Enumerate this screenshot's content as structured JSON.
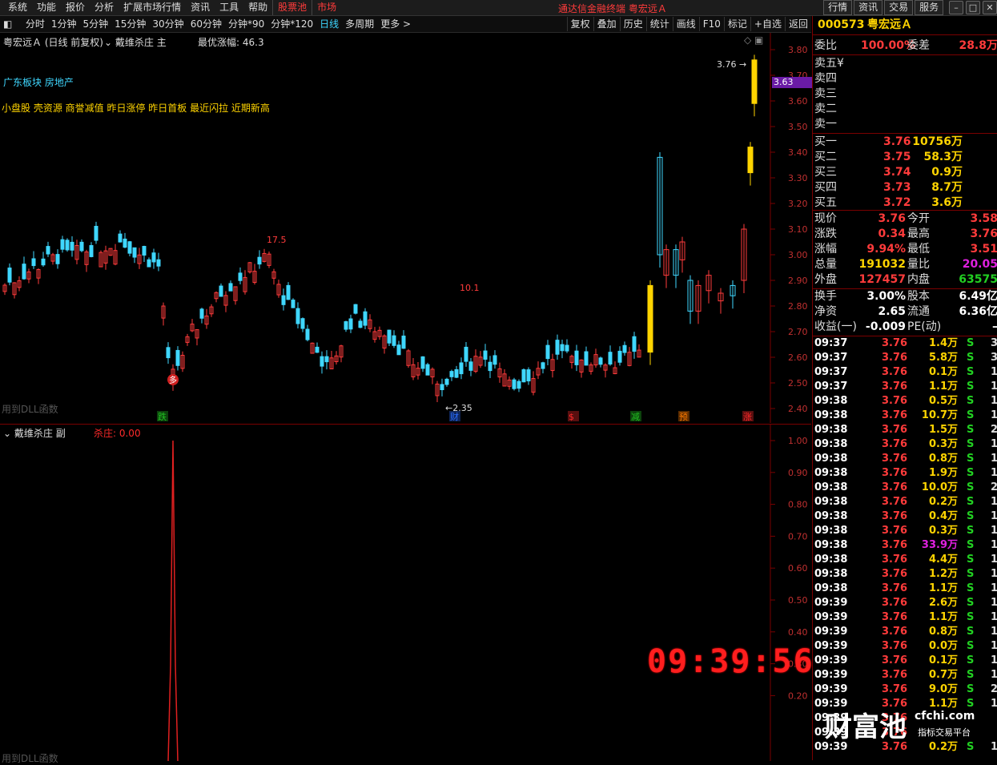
{
  "menubar": {
    "items": [
      "系统",
      "功能",
      "报价",
      "分析",
      "扩展市场行情",
      "资讯",
      "工具",
      "帮助"
    ],
    "red_items": [
      "股票池",
      "市场"
    ],
    "center_title": "通达信金融终端  粤宏远Ａ",
    "right_buttons": [
      "行情",
      "资讯",
      "交易",
      "服务"
    ],
    "window_buttons": [
      "–",
      "□",
      "✕"
    ]
  },
  "toolbar": {
    "periods": [
      "分时",
      "1分钟",
      "5分钟",
      "15分钟",
      "30分钟",
      "60分钟",
      "分钟*90",
      "分钟*120",
      "日线",
      "多周期",
      "更多 >"
    ],
    "active": "日线",
    "right": [
      "复权",
      "叠加",
      "历史",
      "统计",
      "画线",
      "F10",
      "标记",
      "+自选",
      "返回"
    ]
  },
  "main_chart": {
    "title": "粤宏远Ａ (日线 前复权)",
    "indicator": "戴维杀庄 主",
    "optimal_rise_label": "最优涨幅: 46.3",
    "sector_label": "广东板块  房地产",
    "concepts_label": "小盘股 壳资源 商誉减值 昨日涨停 昨日首板 最近闪拉 近期新高",
    "dll_label": "用到DLL函数",
    "price_ticks": [
      "3.80",
      "3.70",
      "3.60",
      "3.50",
      "3.40",
      "3.30",
      "3.20",
      "3.10",
      "3.00",
      "2.90",
      "2.80",
      "2.70",
      "2.60",
      "2.50",
      "2.40"
    ],
    "current_price_tag": "3.63",
    "annotations": {
      "high1": "17.5",
      "high2": "10.1",
      "low": "←2.35",
      "top": "3.76 →"
    },
    "markers": [
      "跌",
      "财",
      "$",
      "减",
      "预",
      "涨"
    ],
    "marker_colors": [
      "#22c022",
      "#2a6cff",
      "#ff2a2a",
      "#22c022",
      "#ff7a00",
      "#ff2a2a"
    ],
    "duo_label": "多"
  },
  "sub_chart": {
    "indicator": "戴维杀庄 副",
    "value_label": "杀庄: 0.00",
    "dll_label": "用到DLL函数",
    "ticks": [
      "1.00",
      "0.90",
      "0.80",
      "0.70",
      "0.60",
      "0.50",
      "0.40",
      "0.30",
      "0.20"
    ]
  },
  "clock": "09:39:56",
  "quote": {
    "code": "000573",
    "name": "粤宏远Ａ",
    "wei_bi_label": "委比",
    "wei_bi": "100.00%",
    "wei_cha_label": "委差",
    "wei_cha": "28.8万",
    "sell_levels": [
      {
        "label": "卖五",
        "price": "¥",
        "vol": ""
      },
      {
        "label": "卖四",
        "price": "",
        "vol": ""
      },
      {
        "label": "卖三",
        "price": "",
        "vol": ""
      },
      {
        "label": "卖二",
        "price": "",
        "vol": ""
      },
      {
        "label": "卖一",
        "price": "",
        "vol": ""
      }
    ],
    "buy_levels": [
      {
        "label": "买一",
        "price": "3.76",
        "vol": "10756万"
      },
      {
        "label": "买二",
        "price": "3.75",
        "vol": "58.3万"
      },
      {
        "label": "买三",
        "price": "3.74",
        "vol": "0.9万"
      },
      {
        "label": "买四",
        "price": "3.73",
        "vol": "8.7万"
      },
      {
        "label": "买五",
        "price": "3.72",
        "vol": "3.6万"
      }
    ],
    "stats": [
      {
        "l1": "现价",
        "v1": "3.76",
        "c1": "#ff3b3b",
        "l2": "今开",
        "v2": "3.58",
        "c2": "#ff3b3b"
      },
      {
        "l1": "涨跌",
        "v1": "0.34",
        "c1": "#ff3b3b",
        "l2": "最高",
        "v2": "3.76",
        "c2": "#ff3b3b"
      },
      {
        "l1": "涨幅",
        "v1": "9.94%",
        "c1": "#ff3b3b",
        "l2": "最低",
        "v2": "3.51",
        "c2": "#ff3b3b"
      },
      {
        "l1": "总量",
        "v1": "191032",
        "c1": "#ffd400",
        "l2": "量比",
        "v2": "20.05",
        "c2": "#e020e0"
      },
      {
        "l1": "外盘",
        "v1": "127457",
        "c1": "#ff3b3b",
        "l2": "内盘",
        "v2": "63575",
        "c2": "#22d022"
      }
    ],
    "stats2": [
      {
        "l1": "换手",
        "v1": "3.00%",
        "l2": "股本",
        "v2": "6.49亿"
      },
      {
        "l1": "净资",
        "v1": "2.65",
        "l2": "流通",
        "v2": "6.36亿"
      },
      {
        "l1": "收益(一)",
        "v1": "-0.009",
        "l2": "PE(动)",
        "v2": "–"
      }
    ]
  },
  "ticks": [
    {
      "t": "09:37",
      "p": "3.76",
      "v": "1.4万",
      "s": "S",
      "n": "3"
    },
    {
      "t": "09:37",
      "p": "3.76",
      "v": "5.8万",
      "s": "S",
      "n": "3"
    },
    {
      "t": "09:37",
      "p": "3.76",
      "v": "0.1万",
      "s": "S",
      "n": "1"
    },
    {
      "t": "09:37",
      "p": "3.76",
      "v": "1.1万",
      "s": "S",
      "n": "1"
    },
    {
      "t": "09:38",
      "p": "3.76",
      "v": "0.5万",
      "s": "S",
      "n": "1"
    },
    {
      "t": "09:38",
      "p": "3.76",
      "v": "10.7万",
      "s": "S",
      "n": "1"
    },
    {
      "t": "09:38",
      "p": "3.76",
      "v": "1.5万",
      "s": "S",
      "n": "2"
    },
    {
      "t": "09:38",
      "p": "3.76",
      "v": "0.3万",
      "s": "S",
      "n": "1"
    },
    {
      "t": "09:38",
      "p": "3.76",
      "v": "0.8万",
      "s": "S",
      "n": "1"
    },
    {
      "t": "09:38",
      "p": "3.76",
      "v": "1.9万",
      "s": "S",
      "n": "1"
    },
    {
      "t": "09:38",
      "p": "3.76",
      "v": "10.0万",
      "s": "S",
      "n": "2"
    },
    {
      "t": "09:38",
      "p": "3.76",
      "v": "0.2万",
      "s": "S",
      "n": "1"
    },
    {
      "t": "09:38",
      "p": "3.76",
      "v": "0.4万",
      "s": "S",
      "n": "1"
    },
    {
      "t": "09:38",
      "p": "3.76",
      "v": "0.3万",
      "s": "S",
      "n": "1"
    },
    {
      "t": "09:38",
      "p": "3.76",
      "v": "33.9万",
      "s": "S",
      "n": "1",
      "hl": true
    },
    {
      "t": "09:38",
      "p": "3.76",
      "v": "4.4万",
      "s": "S",
      "n": "1"
    },
    {
      "t": "09:38",
      "p": "3.76",
      "v": "1.2万",
      "s": "S",
      "n": "1"
    },
    {
      "t": "09:38",
      "p": "3.76",
      "v": "1.1万",
      "s": "S",
      "n": "1"
    },
    {
      "t": "09:39",
      "p": "3.76",
      "v": "2.6万",
      "s": "S",
      "n": "1"
    },
    {
      "t": "09:39",
      "p": "3.76",
      "v": "1.1万",
      "s": "S",
      "n": "1"
    },
    {
      "t": "09:39",
      "p": "3.76",
      "v": "0.8万",
      "s": "S",
      "n": "1"
    },
    {
      "t": "09:39",
      "p": "3.76",
      "v": "0.0万",
      "s": "S",
      "n": "1"
    },
    {
      "t": "09:39",
      "p": "3.76",
      "v": "0.1万",
      "s": "S",
      "n": "1"
    },
    {
      "t": "09:39",
      "p": "3.76",
      "v": "0.7万",
      "s": "S",
      "n": "1"
    },
    {
      "t": "09:39",
      "p": "3.76",
      "v": "9.0万",
      "s": "S",
      "n": "2"
    },
    {
      "t": "09:39",
      "p": "3.76",
      "v": "1.1万",
      "s": "S",
      "n": "1"
    },
    {
      "t": "09:39",
      "p": "3.76",
      "v": "",
      "s": "",
      "n": ""
    },
    {
      "t": "09:39",
      "p": "3.76",
      "v": "",
      "s": "",
      "n": ""
    },
    {
      "t": "09:39",
      "p": "3.76",
      "v": "0.2万",
      "s": "S",
      "n": "1"
    }
  ],
  "watermark": {
    "main": "财富池",
    "domain": "cfchi.com",
    "sub": "指标交易平台"
  }
}
